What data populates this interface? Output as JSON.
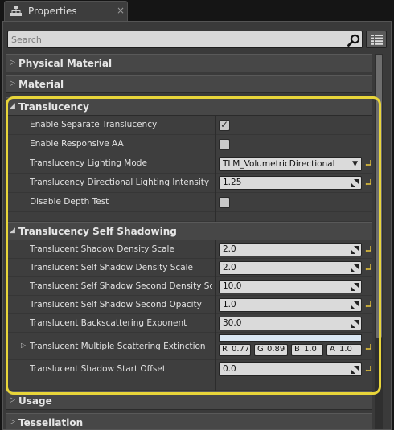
{
  "tab": {
    "title": "Properties",
    "icon": "hierarchy-icon",
    "close_glyph": "×"
  },
  "search": {
    "placeholder": "Search",
    "value": ""
  },
  "colors": {
    "highlight": "#e8d53a",
    "panel": "#3a3a3a",
    "field": "#dadada"
  },
  "categories": {
    "physical_material": {
      "label": "Physical Material",
      "expanded": false
    },
    "material": {
      "label": "Material",
      "expanded": false
    },
    "translucency": {
      "label": "Translucency",
      "expanded": true
    },
    "self_shadowing": {
      "label": "Translucency Self Shadowing",
      "expanded": true
    },
    "usage": {
      "label": "Usage",
      "expanded": false
    },
    "tessellation": {
      "label": "Tessellation",
      "expanded": false
    }
  },
  "translucency": {
    "separate": {
      "label": "Enable Separate Translucency",
      "checked": true
    },
    "responsive_aa": {
      "label": "Enable Responsive AA",
      "checked": false
    },
    "lighting_mode": {
      "label": "Translucency Lighting Mode",
      "value": "TLM_VolumetricDirectional"
    },
    "dir_intensity": {
      "label": "Translucency Directional Lighting Intensity",
      "value": "1.25"
    },
    "depth_test": {
      "label": "Disable Depth Test",
      "checked": false
    }
  },
  "shadowing": {
    "density": {
      "label": "Translucent Shadow Density Scale",
      "value": "2.0"
    },
    "self_density": {
      "label": "Translucent Self Shadow Density Scale",
      "value": "2.0"
    },
    "second_density": {
      "label": "Translucent Self Shadow Second Density Scale",
      "value": "10.0"
    },
    "second_opacity": {
      "label": "Translucent Self Shadow Second Opacity",
      "value": "1.0"
    },
    "backscatter": {
      "label": "Translucent Backscattering Exponent",
      "value": "30.0"
    },
    "extinction": {
      "label": "Translucent Multiple Scattering Extinction",
      "r_key": "R",
      "r": "0.77",
      "g_key": "G",
      "g": "0.89",
      "b_key": "B",
      "b": "1.0",
      "a_key": "A",
      "a": "1.0"
    },
    "start_offset": {
      "label": "Translucent Shadow Start Offset",
      "value": "0.0"
    }
  }
}
